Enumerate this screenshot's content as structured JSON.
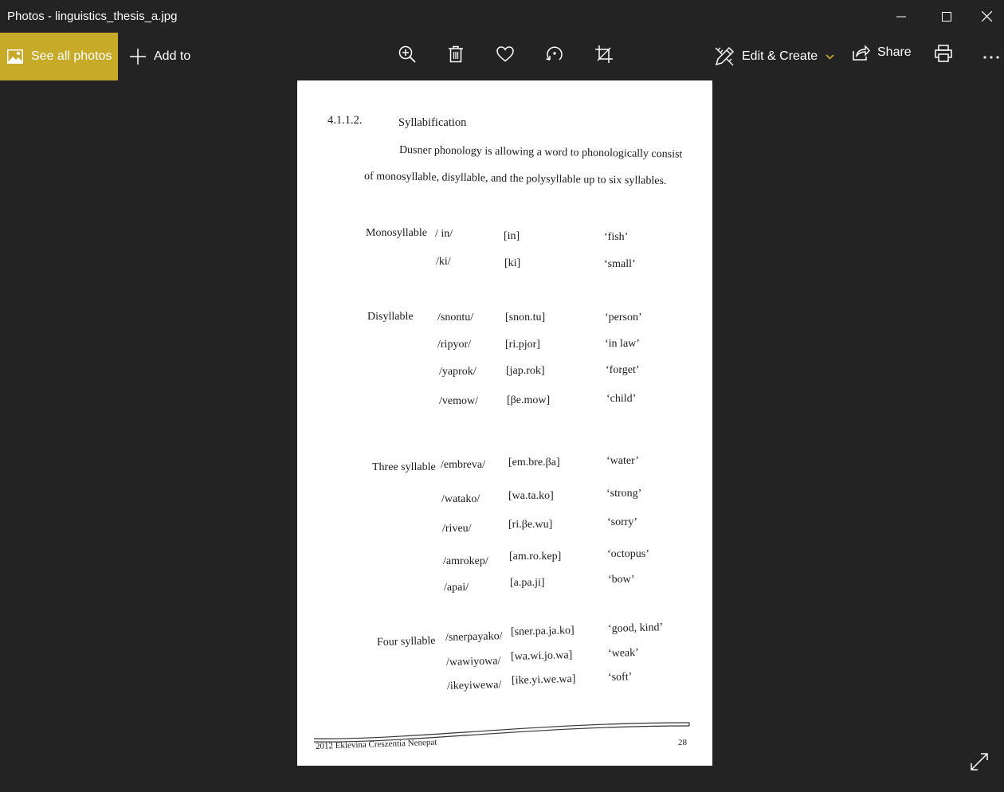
{
  "window": {
    "title": "Photos - linguistics_thesis_a.jpg"
  },
  "toolbar": {
    "see_all_label": "See all photos",
    "add_to_label": "Add to",
    "edit_create_label": "Edit & Create",
    "share_label": "Share"
  },
  "colors": {
    "accent": "#c6aa28",
    "background": "#232323"
  },
  "icons": [
    "photos-icon",
    "plus-icon",
    "zoom-in-icon",
    "delete-icon",
    "heart-icon",
    "rotate-icon",
    "crop-icon",
    "edit-create-icon",
    "chevron-down-icon",
    "share-icon",
    "print-icon",
    "more-icon",
    "minimize-icon",
    "maximize-icon",
    "close-icon",
    "expand-icon"
  ],
  "document": {
    "section_number": "4.1.1.2.",
    "section_title": "Syllabification",
    "para_line1": "Dusner phonology is allowing a word to phonologically consist",
    "para_line2": "of monosyllable, disyllable, and the polysyllable up to six syllables.",
    "groups": [
      {
        "label": "Monosyllable",
        "rows": [
          {
            "phonemic": "/ in/",
            "phonetic": "[in]",
            "gloss": "‘fish’"
          },
          {
            "phonemic": "/ki/",
            "phonetic": "[ki]",
            "gloss": "‘small’"
          }
        ]
      },
      {
        "label": "Disyllable",
        "rows": [
          {
            "phonemic": "/snontu/",
            "phonetic": "[snon.tu]",
            "gloss": "‘person’"
          },
          {
            "phonemic": "/ripyor/",
            "phonetic": "[ri.pjor]",
            "gloss": "‘in law’"
          },
          {
            "phonemic": "/yaprok/",
            "phonetic": "[jap.rok]",
            "gloss": "‘forget’"
          },
          {
            "phonemic": "/vemow/",
            "phonetic": "[βe.mow]",
            "gloss": "‘child’"
          }
        ]
      },
      {
        "label": "Three syllable",
        "rows": [
          {
            "phonemic": "/embreva/",
            "phonetic": "[em.bre.βa]",
            "gloss": "‘water’"
          },
          {
            "phonemic": "/watako/",
            "phonetic": "[wa.ta.ko]",
            "gloss": "‘strong’"
          },
          {
            "phonemic": "/riveu/",
            "phonetic": "[ri.βe.wu]",
            "gloss": "‘sorry’"
          },
          {
            "phonemic": "/amrokep/",
            "phonetic": "[am.ro.kep]",
            "gloss": "‘octopus’"
          },
          {
            "phonemic": "/apai/",
            "phonetic": "[a.pa.ji]",
            "gloss": "‘bow’"
          }
        ]
      },
      {
        "label": "Four syllable",
        "rows": [
          {
            "phonemic": "/snerpayako/",
            "phonetic": "[sner.pa.ja.ko]",
            "gloss": "‘good, kind’"
          },
          {
            "phonemic": "/wawiyowa/",
            "phonetic": "[wa.wi.jo.wa]",
            "gloss": "‘weak’"
          },
          {
            "phonemic": "/ikeyiwewa/",
            "phonetic": "[ike.yi.we.wa]",
            "gloss": "‘soft’"
          }
        ]
      }
    ],
    "footer_author": "2012 Eklevina Creszentia Nenepat",
    "page_number": "28"
  }
}
